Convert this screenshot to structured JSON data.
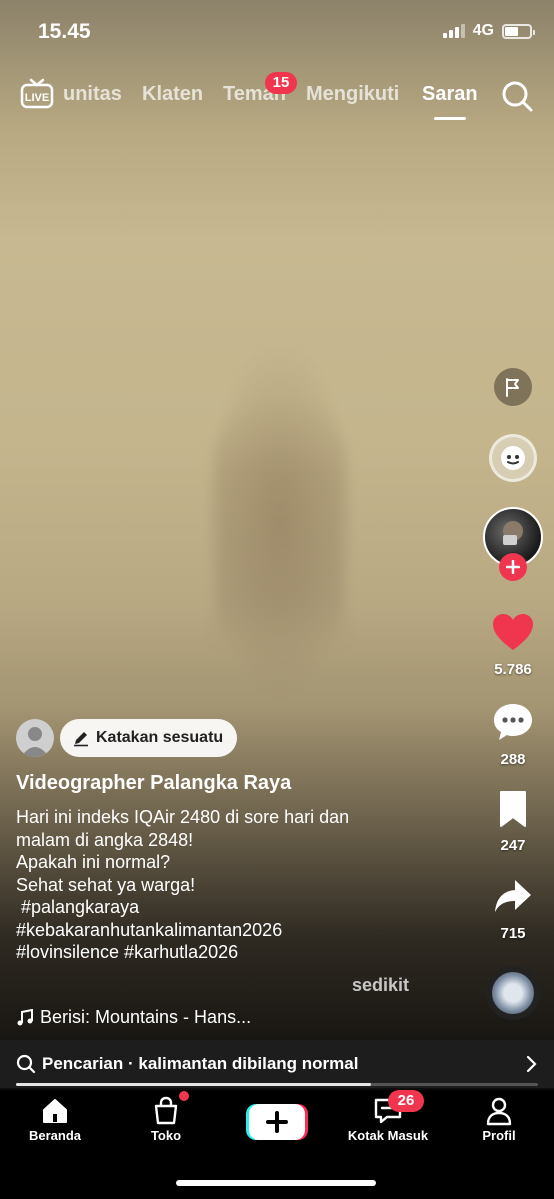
{
  "status": {
    "time": "15.45",
    "network": "4G"
  },
  "top_nav": {
    "tabs": [
      "unitas",
      "Klaten",
      "Teman",
      "Mengikuti",
      "Saran"
    ],
    "active_tab": "Saran",
    "friends_badge": "15"
  },
  "rail": {
    "likes": "5.786",
    "comments": "288",
    "saves": "247",
    "shares": "715"
  },
  "post": {
    "say_something": "Katakan sesuatu",
    "username": "Videographer Palangka Raya",
    "caption_lines": [
      "Hari ini indeks IQAir 2480 di sore hari dan",
      "malam di angka 2848!",
      "Apakah ini normal?",
      "Sehat sehat ya warga!",
      " #palangkaraya",
      "#kebakaranhutankalimantan2026",
      "#lovinsilence #karhutla2026"
    ],
    "more": "sedikit",
    "music": "Berisi: Mountains - Hans..."
  },
  "search_suggestion": {
    "text": "Pencarian · kalimantan dibilang normal",
    "progress_fraction": 0.68
  },
  "bottom_nav": {
    "home": "Beranda",
    "shop": "Toko",
    "inbox": "Kotak Masuk",
    "inbox_badge": "26",
    "profile": "Profil"
  },
  "colors": {
    "accent": "#f0364f",
    "like": "#f0364f"
  }
}
